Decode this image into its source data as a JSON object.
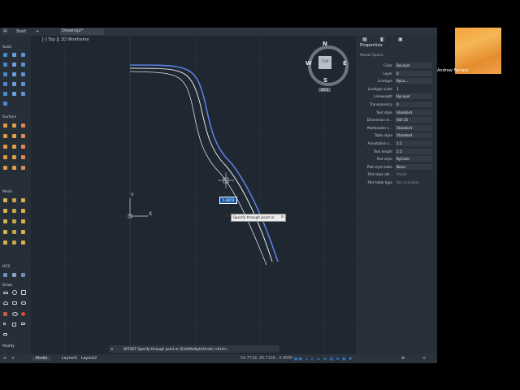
{
  "tabs": {
    "start": "Start",
    "drawing": "Drawing2*"
  },
  "viewport_label": "[-] Top ][ 2D Wireframe",
  "viewcube": {
    "n": "N",
    "s": "S",
    "e": "E",
    "w": "W",
    "top": "TOP",
    "wcs": "WCS"
  },
  "left_panel": {
    "solid": "Solid",
    "surface": "Surface",
    "mesh": "Mesh",
    "ucs": "UCS",
    "draw": "Draw",
    "modify": "Modify"
  },
  "ucs_icon": {
    "x": "X",
    "y": "Y"
  },
  "dynamic_input": {
    "value": "5.4879",
    "prompt": "Specify through point or"
  },
  "properties": {
    "title": "Properties",
    "subtitle": "Model Space",
    "rows": [
      {
        "label": "Color",
        "value": "ByLayer"
      },
      {
        "label": "Layer",
        "value": "0"
      },
      {
        "label": "Linetype",
        "value": "ByLa..."
      },
      {
        "label": "Linetype scale",
        "value": "1"
      },
      {
        "label": "Lineweight",
        "value": "ByLayer"
      },
      {
        "label": "Transparency",
        "value": "0"
      },
      {
        "label": "Text style",
        "value": "Standard"
      },
      {
        "label": "Dimension st...",
        "value": "ISO-25"
      },
      {
        "label": "Multileader s...",
        "value": "Standard"
      },
      {
        "label": "Table style",
        "value": "Standard"
      },
      {
        "label": "Annotation s...",
        "value": "1:1"
      },
      {
        "label": "Text height",
        "value": "2.5"
      },
      {
        "label": "Plot style",
        "value": "ByColor"
      },
      {
        "label": "Plot style table",
        "value": "None"
      },
      {
        "label": "Plot style att...",
        "value": "Model"
      },
      {
        "label": "Plot table type",
        "value": "Not available"
      }
    ]
  },
  "command_line": "OFFSET Specify through point or [Exit/Multiple/Undo] <Exit>:",
  "bottom_tabs": {
    "model": "Model",
    "layout1": "Layout1",
    "layout2": "Layout2"
  },
  "coordinates": "54.7719, 26.7109 , 0.0000",
  "user_name": "Andrew Ferrara",
  "colors": {
    "canvas": "#1f2731",
    "curve": "#5a7fe0",
    "accent": "#3a8ef0"
  }
}
